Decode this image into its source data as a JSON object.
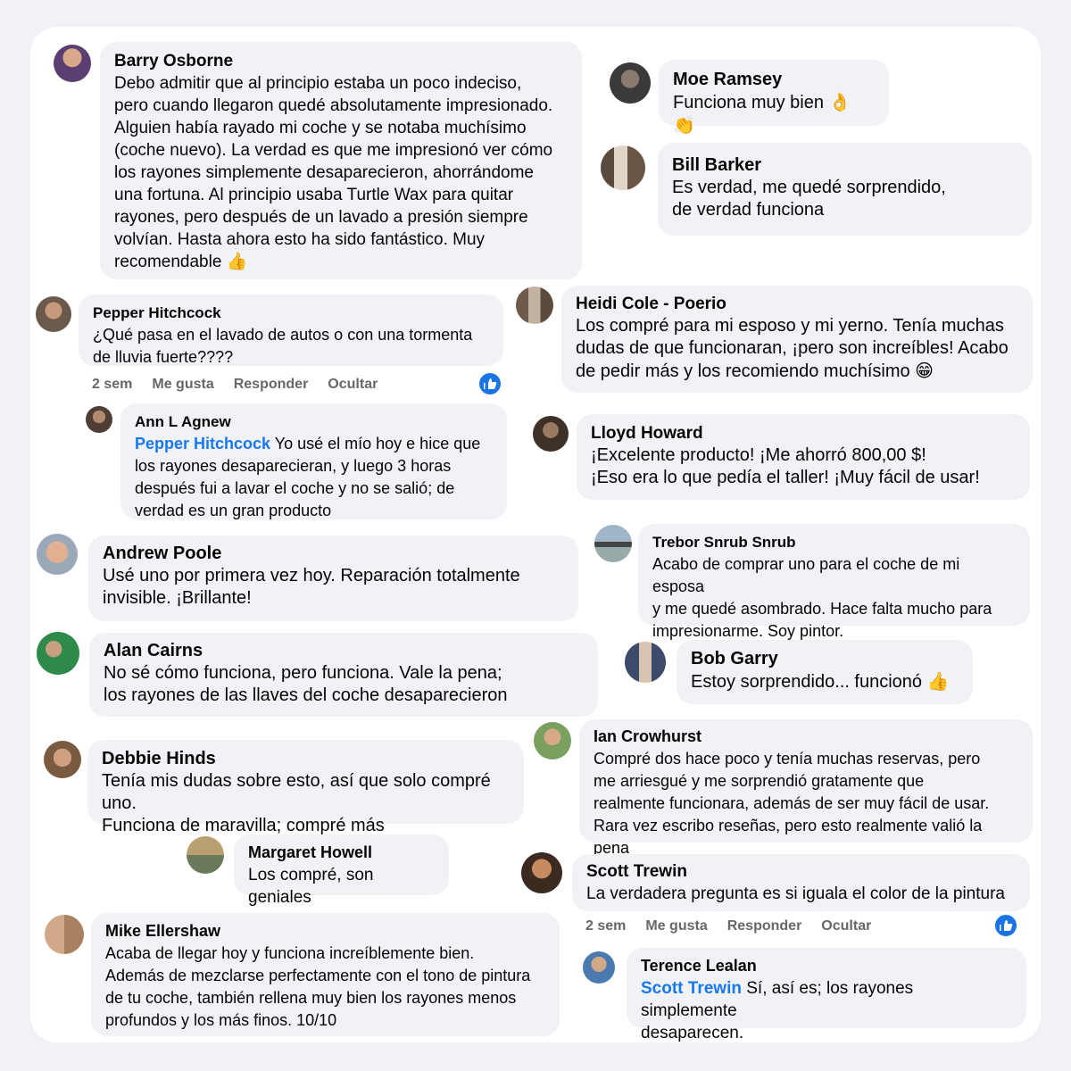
{
  "comments": [
    {
      "name": "Barry Osborne",
      "text": "Debo admitir que al principio estaba un poco indeciso,\npero cuando llegaron quedé absolutamente impresionado.\nAlguien había rayado mi coche y se notaba muchísimo\n(coche nuevo). La verdad es que me impresionó ver cómo\nlos rayones simplemente desaparecieron, ahorrándome\nuna fortuna. Al principio usaba Turtle Wax para quitar\nrayones, pero después de un lavado a presión siempre\nvolvían. Hasta ahora esto ha sido fantástico. Muy\nrecomendable",
      "emoji": "👍"
    },
    {
      "name": "Moe Ramsey",
      "text": "Funciona muy bien",
      "emoji": "👌 👏"
    },
    {
      "name": "Bill Barker",
      "text": "Es verdad, me quedé sorprendido,\nde verdad funciona"
    },
    {
      "name": "Pepper Hitchcock",
      "text": "¿Qué  pasa en el lavado de autos o con una tormenta\nde lluvia fuerte????"
    },
    {
      "name": "Heidi Cole - Poerio",
      "text": "Los compré para mi esposo y mi yerno. Tenía muchas\ndudas de que funcionaran, ¡pero son increíbles! Acabo\nde pedir más y los recomiendo muchísimo",
      "emoji": "😁"
    },
    {
      "name": "Ann L Agnew",
      "mention": "Pepper Hitchcock",
      "text": " Yo usé el mío hoy e hice que\nlos rayones desaparecieran, y luego 3 horas\ndespués fui a lavar el coche y no se salió; de\nverdad es un gran producto"
    },
    {
      "name": "Lloyd Howard",
      "text": "¡Excelente producto! ¡Me ahorró 800,00 $!\n¡Eso era lo que pedía el taller! ¡Muy fácil de usar!"
    },
    {
      "name": "Andrew Poole",
      "text": "Usé uno por primera vez hoy. Reparación totalmente\ninvisible. ¡Brillante!"
    },
    {
      "name": "Trebor Snrub Snrub",
      "text": "Acabo de comprar uno para el coche de mi esposa\ny me quedé asombrado. Hace falta mucho para\nimpresionarme. Soy pintor."
    },
    {
      "name": "Alan Cairns",
      "text": "No sé cómo funciona, pero funciona. Vale la pena;\nlos rayones de las llaves del coche desaparecieron"
    },
    {
      "name": "Bob Garry",
      "text": "Estoy sorprendido... funcionó",
      "emoji": "👍"
    },
    {
      "name": "Debbie Hinds",
      "text": "Tenía mis dudas sobre esto, así que solo compré uno.\nFunciona de maravilla; compré más"
    },
    {
      "name": "Ian Crowhurst",
      "text": "Compré dos hace poco y tenía muchas reservas, pero\nme arriesgué y me sorprendió gratamente que\nrealmente funcionara, además de ser muy fácil de usar.\nRara vez escribo reseñas, pero esto realmente valió la pena"
    },
    {
      "name": "Margaret Howell",
      "text": "Los compré, son geniales"
    },
    {
      "name": "Scott Trewin",
      "text": "La verdadera pregunta es si iguala el color de la pintura"
    },
    {
      "name": "Mike Ellershaw",
      "text": "Acaba de llegar hoy y funciona increíblemente bien.\nAdemás de mezclarse perfectamente con el tono de pintura\nde tu coche, también rellena muy bien los rayones menos\nprofundos y los más finos. 10/10"
    },
    {
      "name": "Terence Lealan",
      "mention": "Scott Trewin",
      "text": " Sí, así es; los rayones simplemente\ndesaparecen."
    }
  ],
  "actions": [
    {
      "time": "2 sem",
      "like": "Me gusta",
      "reply": "Responder",
      "hide": "Ocultar"
    },
    {
      "time": "2 sem",
      "like": "Me gusta",
      "reply": "Responder",
      "hide": "Ocultar"
    }
  ],
  "colors": {
    "bubble": "#f0f2f5",
    "mention": "#1877f2",
    "like_badge": "#1b74e4",
    "meta": "#65676b"
  }
}
